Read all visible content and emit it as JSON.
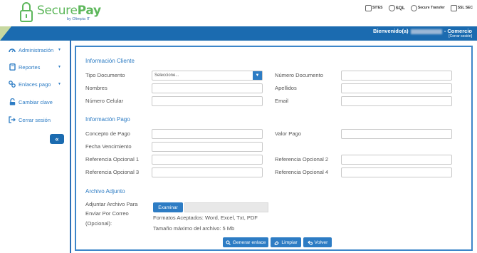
{
  "brand": {
    "name_light": "Secure",
    "name_bold": "Pay",
    "subtitle": "by Olimpia IT"
  },
  "badges": [
    {
      "icon": "security-seal-icon",
      "label": "SITES"
    },
    {
      "icon": "shield-icon",
      "label": "SQL"
    },
    {
      "icon": "lock-icon",
      "label": "Secure Transfer"
    },
    {
      "icon": "ssl-icon",
      "label": "SSL SEC"
    }
  ],
  "topbar": {
    "welcome_prefix": "Bienvenido(a)",
    "welcome_suffix": "- Comercio",
    "logout_small": "[Cerrar sesión]"
  },
  "sidebar": {
    "items": [
      {
        "label": "Administración",
        "icon": "dashboard-icon",
        "has_caret": true
      },
      {
        "label": "Reportes",
        "icon": "book-icon",
        "has_caret": true
      },
      {
        "label": "Enlaces pago",
        "icon": "link-icon",
        "has_caret": true
      },
      {
        "label": "Cambiar clave",
        "icon": "unlock-icon",
        "has_caret": false
      },
      {
        "label": "Cerrar sesión",
        "icon": "sign-out-icon",
        "has_caret": false
      }
    ],
    "collapse_label": "«"
  },
  "form": {
    "section_cliente": "Información Cliente",
    "tipo_documento": {
      "label": "Tipo Documento",
      "value": "Seleccione..."
    },
    "numero_documento": {
      "label": "Número Documento",
      "value": ""
    },
    "nombres": {
      "label": "Nombres",
      "value": ""
    },
    "apellidos": {
      "label": "Apellidos",
      "value": ""
    },
    "numero_celular": {
      "label": "Número Celular",
      "value": ""
    },
    "email": {
      "label": "Email",
      "value": ""
    },
    "section_pago": "Información Pago",
    "concepto_pago": {
      "label": "Concepto de Pago",
      "value": ""
    },
    "valor_pago": {
      "label": "Valor Pago",
      "value": ""
    },
    "fecha_vencimiento": {
      "label": "Fecha Vencimiento",
      "value": ""
    },
    "ref1": {
      "label": "Referencia Opcional 1",
      "value": ""
    },
    "ref2": {
      "label": "Referencia Opcional 2",
      "value": ""
    },
    "ref3": {
      "label": "Referencia Opcional 3",
      "value": ""
    },
    "ref4": {
      "label": "Referencia Opcional 4",
      "value": ""
    },
    "section_adjunto": "Archivo Adjunto",
    "adjuntar_label_1": "Adjuntar Archivo Para",
    "adjuntar_label_2": "Enviar Por Correo",
    "adjuntar_label_3": "(Opcional):",
    "examinar": "Examinar",
    "formatos": "Formatos Aceptados: Word, Excel, Txt, PDF",
    "tamano": "Tamaño máximo del archivo: 5 Mb"
  },
  "actions": {
    "generar": "Generar enlace",
    "limpiar": "Limpiar",
    "volver": "Volver"
  },
  "colors": {
    "brand_green": "#5db75b",
    "primary_blue": "#1b6bb0",
    "link_blue": "#2d7cc4"
  }
}
